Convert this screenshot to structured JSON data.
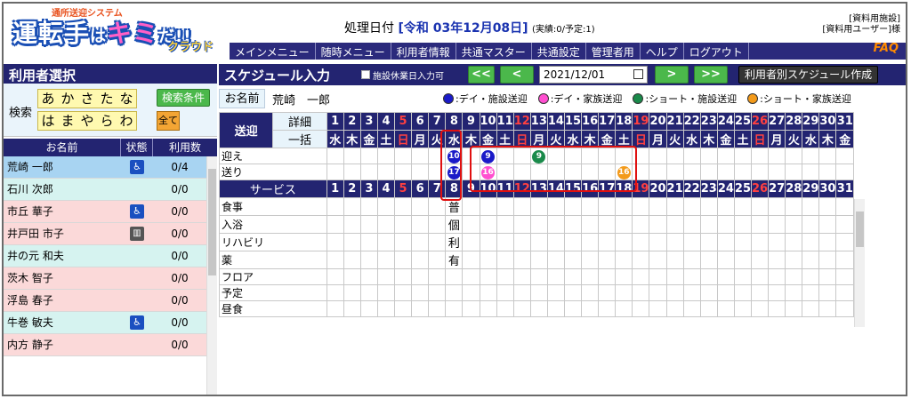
{
  "logo": {
    "sub": "通所送迎システム",
    "main_a": "運転手",
    "main_b": "は",
    "main_c": "キミ",
    "main_d": "だ!!",
    "cloud": "クラウド"
  },
  "header": {
    "proc_label": "処理日付",
    "proc_date": "[令和 03年12月08日]",
    "proc_counts": "(実績:0/予定:1)",
    "facility": "[資料用施設]",
    "user": "[資料用ユーザー]様"
  },
  "menu": [
    "メインメニュー",
    "随時メニュー",
    "利用者情報",
    "共通マスター",
    "共通設定",
    "管理者用",
    "ヘルプ",
    "ログアウト"
  ],
  "faq": "FAQ",
  "left": {
    "title": "利用者選択",
    "search_label": "検索",
    "kana_row1": [
      "あ",
      "か",
      "さ",
      "た",
      "な"
    ],
    "kana_row2": [
      "は",
      "ま",
      "や",
      "ら",
      "わ"
    ],
    "all_label": "全て",
    "search_cond": "検索条件",
    "col_name": "お名前",
    "col_status": "状態",
    "col_count": "利用数",
    "users": [
      {
        "name": "荒崎 一郎",
        "status": "wheelchair",
        "count": "0/4",
        "bg": "#a8d4f2"
      },
      {
        "name": "石川 次郎",
        "status": "",
        "count": "0/0",
        "bg": "#d6f3f0"
      },
      {
        "name": "市丘 華子",
        "status": "wheelchair",
        "count": "0/0",
        "bg": "#fbd9d9"
      },
      {
        "name": "井戸田 市子",
        "status": "walker",
        "count": "0/0",
        "bg": "#fbd9d9"
      },
      {
        "name": "井の元 和夫",
        "status": "",
        "count": "0/0",
        "bg": "#d6f3f0"
      },
      {
        "name": "茨木 智子",
        "status": "",
        "count": "0/0",
        "bg": "#fbd9d9"
      },
      {
        "name": "浮島 春子",
        "status": "",
        "count": "0/0",
        "bg": "#fbd9d9"
      },
      {
        "name": "牛巻 敏夫",
        "status": "wheelchair",
        "count": "0/0",
        "bg": "#d6f3f0"
      },
      {
        "name": "内方 静子",
        "status": "",
        "count": "0/0",
        "bg": "#fbd9d9"
      }
    ]
  },
  "main": {
    "title": "スケジュール入力",
    "holiday_check": "施設休業日入力可",
    "nav_prev2": "<<",
    "nav_prev": "<",
    "date_value": "2021/12/01",
    "nav_next": ">",
    "nav_next2": ">>",
    "user_sched_btn": "利用者別スケジュール作成",
    "name_label": "お名前",
    "name_value": "荒崎　一郎",
    "legend": [
      {
        "label": ":デイ・施設送迎",
        "color": "#1a1ac8"
      },
      {
        "label": ":デイ・家族送迎",
        "color": "#ff4fd0"
      },
      {
        "label": ":ショート・施設送迎",
        "color": "#1a8a4a"
      },
      {
        "label": ":ショート・家族送迎",
        "color": "#f39a1a"
      }
    ],
    "sougei_label": "送迎",
    "detail_label": "詳細",
    "bulk_label": "一括",
    "service_label": "サービス",
    "days": [
      "1",
      "2",
      "3",
      "4",
      "5",
      "6",
      "7",
      "8",
      "9",
      "10",
      "11",
      "12",
      "13",
      "14",
      "15",
      "16",
      "17",
      "18",
      "19",
      "20",
      "21",
      "22",
      "23",
      "24",
      "25",
      "26",
      "27",
      "28",
      "29",
      "30",
      "31"
    ],
    "weekdays": [
      "水",
      "木",
      "金",
      "土",
      "日",
      "月",
      "火",
      "水",
      "木",
      "金",
      "土",
      "日",
      "月",
      "火",
      "水",
      "木",
      "金",
      "土",
      "日",
      "月",
      "火",
      "水",
      "木",
      "金",
      "土",
      "日",
      "月",
      "火",
      "水",
      "木",
      "金"
    ],
    "sundays": [
      "5",
      "12",
      "19",
      "26"
    ],
    "rows_sougei": [
      {
        "label": "迎え",
        "marks": [
          {
            "day": 8,
            "num": "10",
            "color": "#1a1ac8"
          },
          {
            "day": 10,
            "num": "9",
            "color": "#1a1ac8"
          },
          {
            "day": 13,
            "num": "9",
            "color": "#1a8a4a"
          }
        ]
      },
      {
        "label": "送り",
        "marks": [
          {
            "day": 8,
            "num": "17",
            "color": "#1a1ac8"
          },
          {
            "day": 10,
            "num": "16",
            "color": "#ff4fd0"
          },
          {
            "day": 18,
            "num": "16",
            "color": "#f39a1a"
          }
        ]
      }
    ],
    "rows_service": [
      {
        "label": "食事",
        "day8": "普"
      },
      {
        "label": "入浴",
        "day8": "個"
      },
      {
        "label": "リハビリ",
        "day8": "利"
      },
      {
        "label": "薬",
        "day8": "有"
      },
      {
        "label": "フロア",
        "day8": ""
      },
      {
        "label": "予定",
        "day8": ""
      },
      {
        "label": "昼食",
        "day8": ""
      }
    ]
  }
}
